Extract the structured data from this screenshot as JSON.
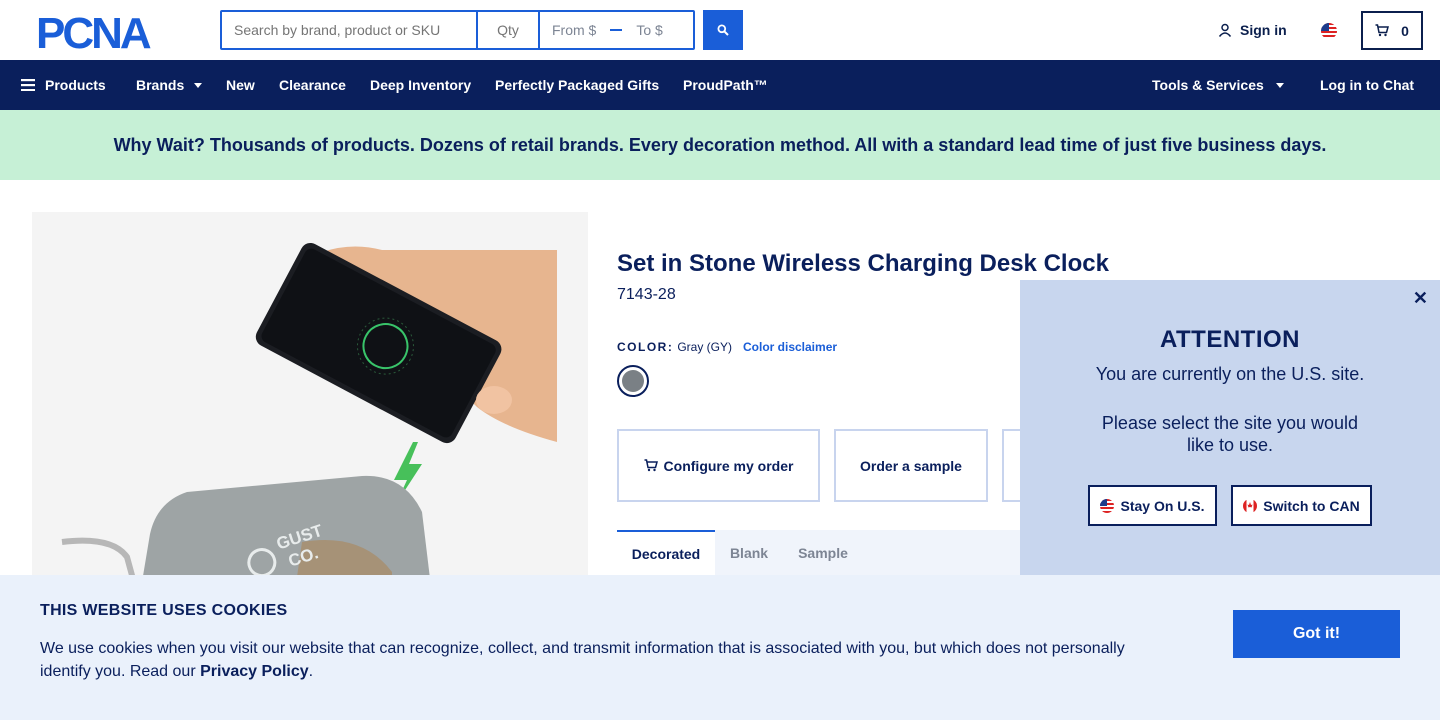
{
  "header": {
    "logo_text": "PCNA",
    "search_placeholder": "Search by brand, product or SKU",
    "qty_placeholder": "Qty",
    "price_from": "From $",
    "price_to": "To $",
    "signin_label": "Sign in",
    "cart_count": "0"
  },
  "nav": {
    "left_items": [
      "Products",
      "Brands",
      "New",
      "Clearance",
      "Deep Inventory",
      "Perfectly Packaged Gifts",
      "ProudPath™"
    ],
    "tools_label": "Tools & Services",
    "chat_label": "Log in to Chat"
  },
  "promo": {
    "text": "Why Wait? Thousands of products. Dozens of retail brands. Every decoration method. All with a standard lead time of just five business days."
  },
  "product": {
    "title": "Set in Stone Wireless Charging Desk Clock",
    "sku": "7143-28",
    "image_logo_line1": "GUST",
    "image_logo_line2": "CO.",
    "color_label": "COLOR:",
    "color_value": "Gray (GY)",
    "color_disclaimer": "Color disclaimer",
    "swatch_color": "#7a8085",
    "actions": {
      "configure": "Configure my order",
      "sample": "Order a sample"
    },
    "tabs": [
      "Decorated",
      "Blank",
      "Sample"
    ]
  },
  "attention": {
    "title": "ATTENTION",
    "line1": "You are currently on the U.S. site.",
    "line2": "Please select the site you would like to use.",
    "stay_label": "Stay On U.S.",
    "switch_label": "Switch to CAN"
  },
  "cookie": {
    "title": "THIS WEBSITE USES COOKIES",
    "text": "We use cookies when you visit our website that can recognize, collect, and transmit information that is associated with you, but which does not personally identify you. Read our",
    "policy_link": "Privacy Policy",
    "button": "Got it!"
  },
  "colors": {
    "navy": "#0a1f5c",
    "accent_blue": "#1a5ed8",
    "promo_green": "#c6f0d6",
    "popup_bg": "#c8d6ee"
  }
}
